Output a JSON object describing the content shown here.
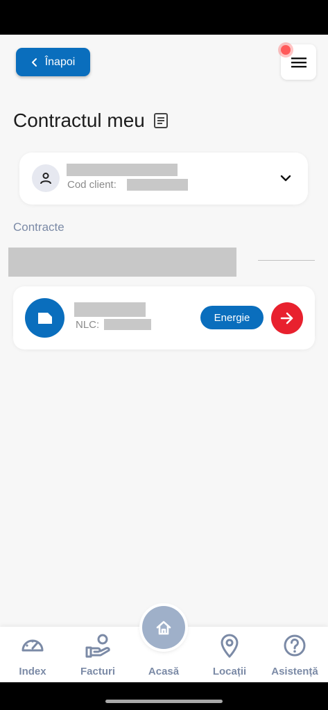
{
  "header": {
    "back_label": "Înapoi"
  },
  "page": {
    "title": "Contractul meu"
  },
  "client": {
    "code_label": "Cod client:"
  },
  "contracts": {
    "section_label": "Contracte",
    "items": [
      {
        "nlc_label": "NLC:",
        "badge": "Energie"
      }
    ]
  },
  "bottom_nav": {
    "items": [
      {
        "label": "Index",
        "icon": "gauge-icon"
      },
      {
        "label": "Facturi",
        "icon": "hand-coin-icon"
      },
      {
        "label": "Acasă",
        "icon": "home-icon"
      },
      {
        "label": "Locații",
        "icon": "location-pin-icon"
      },
      {
        "label": "Asistență",
        "icon": "help-circle-icon"
      }
    ]
  },
  "colors": {
    "primary": "#0a6ebd",
    "accent_red": "#e8212e",
    "muted_text": "#7b8aa6",
    "background": "#f7f7f7"
  }
}
